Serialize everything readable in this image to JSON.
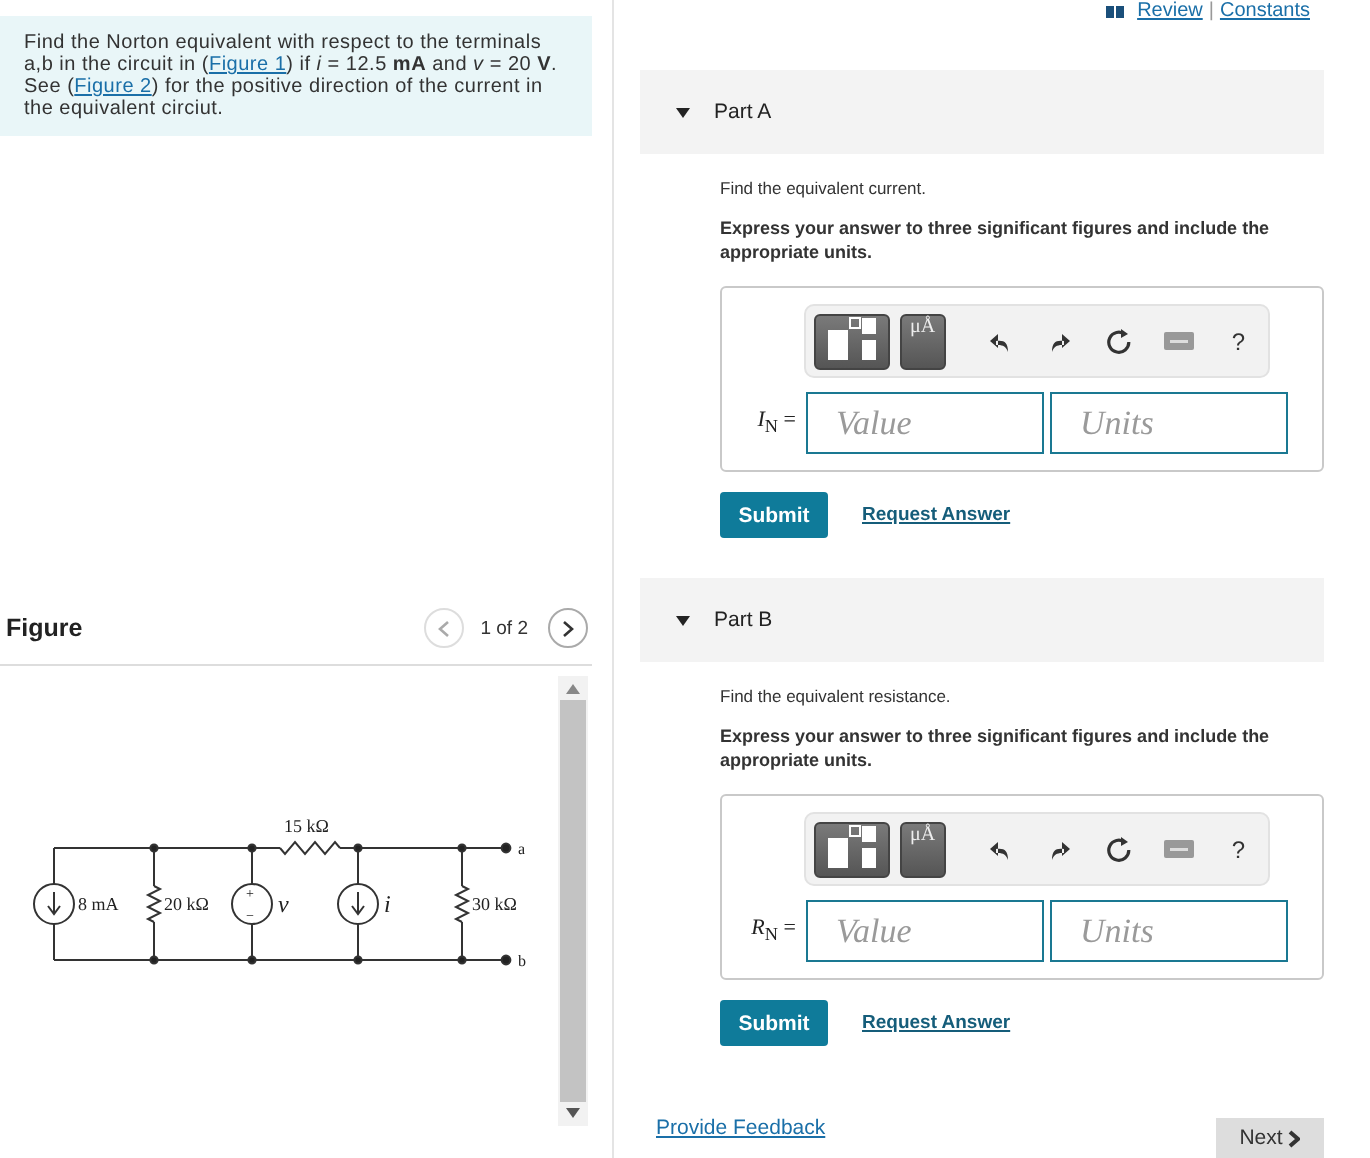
{
  "problem": {
    "parts": [
      {
        "kind": "text",
        "text": "Find the Norton equivalent with respect to the terminals a,b in the circuit in ("
      },
      {
        "kind": "link",
        "text": "Figure 1"
      },
      {
        "kind": "text",
        "text": ") if *i* = 12.5 **mA** and *v* = 20 **V**. See ("
      },
      {
        "kind": "link",
        "text": "Figure 2"
      },
      {
        "kind": "text",
        "text": ") for the positive direction of the current in the equivalent circiut."
      }
    ]
  },
  "top_links": [
    "Review",
    "|",
    "Constants"
  ],
  "figure": {
    "title": "Figure",
    "pager": "1 of 2",
    "prev_disabled": true,
    "next_disabled": false,
    "circuit": {
      "top_resistor": "15 kΩ",
      "source_current": "8 mA",
      "left_resistor": "20 kΩ",
      "voltage": "v",
      "plus": "+",
      "minus": "−",
      "current": "i",
      "right_resistor": "30 kΩ",
      "terminal_a": "a",
      "terminal_b": "b"
    }
  },
  "parts": [
    {
      "title": "Part A",
      "expanded": true,
      "prompt": "Find the equivalent current.",
      "instruction": "Express your answer to three significant figures and include the appropriate units.",
      "units_button": "μÅ",
      "help": "?",
      "variable": "*I*$_{N}$ =",
      "value_placeholder": "Value",
      "units_placeholder": "Units",
      "submit": "Submit",
      "request": "Request Answer"
    },
    {
      "title": "Part B",
      "expanded": true,
      "prompt": "Find the equivalent resistance.",
      "instruction": "Express your answer to three significant figures and include the appropriate units.",
      "units_button": "μÅ",
      "help": "?",
      "variable": "*R*$_{N}$ =",
      "value_placeholder": "Value",
      "units_placeholder": "Units",
      "submit": "Submit",
      "request": "Request Answer"
    }
  ],
  "footer": {
    "feedback": "Provide Feedback",
    "next": "Next"
  }
}
